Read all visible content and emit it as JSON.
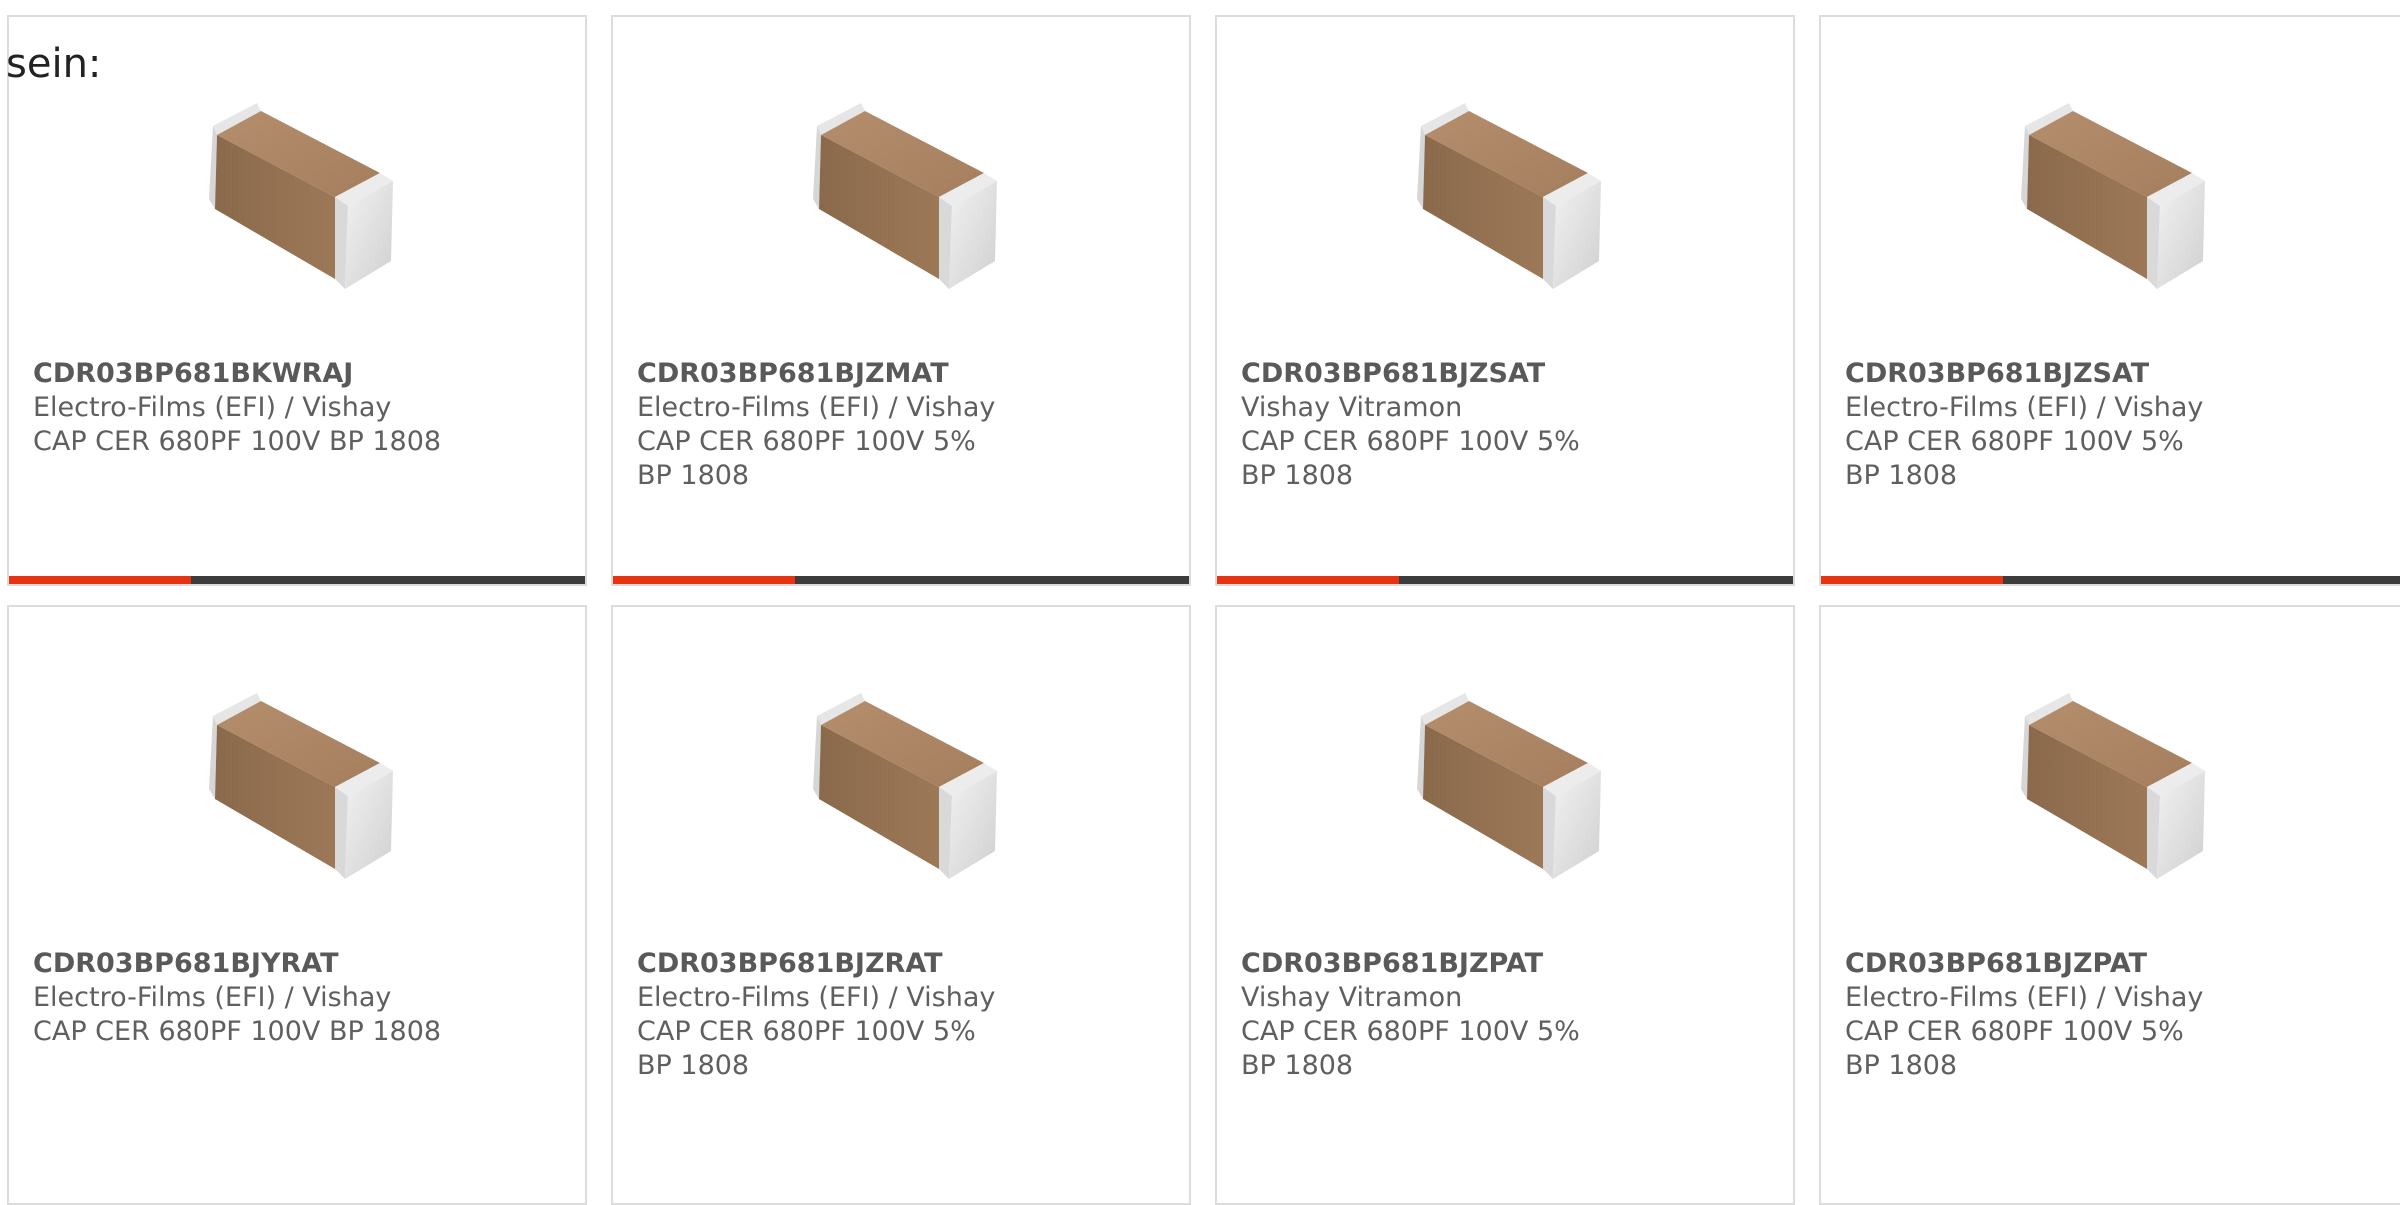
{
  "lead_text": "sein:",
  "colors": {
    "accent": "#e63312",
    "bar": "#3c3c3c",
    "card_border": "#dcdcdc",
    "text": "#5f5f5f"
  },
  "products": [
    {
      "part_number": "CDR03BP681BKWRAJ",
      "manufacturer": "Electro-Films (EFI) / Vishay",
      "description": "CAP CER 680PF 100V BP 1808",
      "image_icon": "ceramic-capacitor-smd-icon"
    },
    {
      "part_number": "CDR03BP681BJZMAT",
      "manufacturer": "Electro-Films (EFI) / Vishay",
      "description": "CAP CER 680PF 100V 5% BP 1808",
      "image_icon": "ceramic-capacitor-smd-icon"
    },
    {
      "part_number": "CDR03BP681BJZSAT",
      "manufacturer": "Vishay Vitramon",
      "description": "CAP CER 680PF 100V 5% BP 1808",
      "image_icon": "ceramic-capacitor-smd-icon"
    },
    {
      "part_number": "CDR03BP681BJZSAT",
      "manufacturer": "Electro-Films (EFI) / Vishay",
      "description": "CAP CER 680PF 100V 5% BP 1808",
      "image_icon": "ceramic-capacitor-smd-icon"
    },
    {
      "part_number": "CDR03BP681BJYRAT",
      "manufacturer": "Electro-Films (EFI) / Vishay",
      "description": "CAP CER 680PF 100V BP 1808",
      "image_icon": "ceramic-capacitor-smd-icon"
    },
    {
      "part_number": "CDR03BP681BJZRAT",
      "manufacturer": "Electro-Films (EFI) / Vishay",
      "description": "CAP CER 680PF 100V 5% BP 1808",
      "image_icon": "ceramic-capacitor-smd-icon"
    },
    {
      "part_number": "CDR03BP681BJZPAT",
      "manufacturer": "Vishay Vitramon",
      "description": "CAP CER 680PF 100V 5% BP 1808",
      "image_icon": "ceramic-capacitor-smd-icon"
    },
    {
      "part_number": "CDR03BP681BJZPAT",
      "manufacturer": "Electro-Films (EFI) / Vishay",
      "description": "CAP CER 680PF 100V 5% BP 1808",
      "image_icon": "ceramic-capacitor-smd-icon"
    }
  ]
}
